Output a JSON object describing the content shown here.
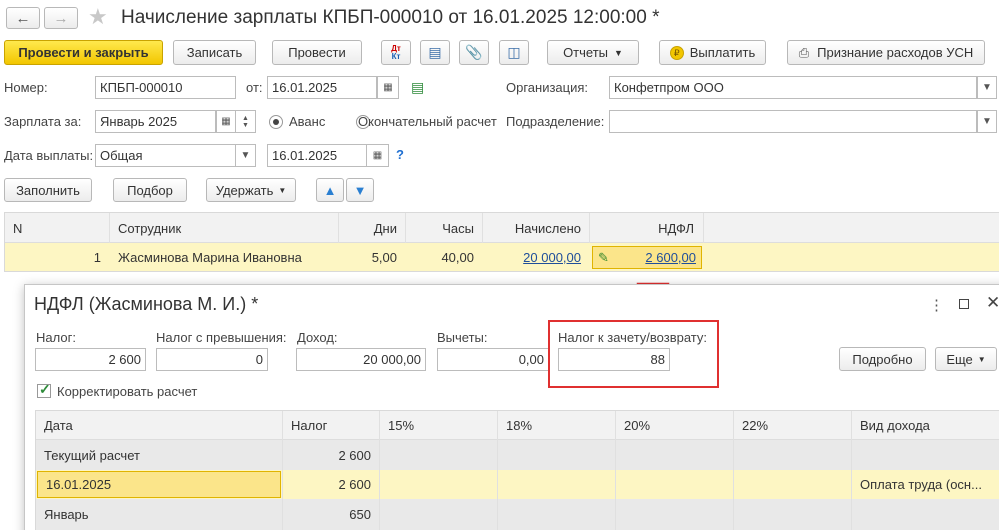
{
  "window": {
    "title": "Начисление зарплаты КПБП-000010 от 16.01.2025 12:00:00 *"
  },
  "toolbar": {
    "post_close": "Провести и закрыть",
    "save": "Записать",
    "post": "Провести",
    "reports": "Отчеты",
    "pay": "Выплатить",
    "usn": "Признание расходов УСН"
  },
  "form": {
    "number_label": "Номер:",
    "number_value": "КПБП-000010",
    "from_label": "от:",
    "date_value": "16.01.2025",
    "org_label": "Организация:",
    "org_value": "Конфетпром ООО",
    "salary_label": "Зарплата за:",
    "salary_value": "Январь 2025",
    "advance_label": "Аванс",
    "final_label": "Окончательный расчет",
    "dept_label": "Подразделение:",
    "dept_value": "",
    "pay_date_label": "Дата выплаты:",
    "pay_type_value": "Общая",
    "pay_date_value": "16.01.2025",
    "help": "?"
  },
  "actions": {
    "fill": "Заполнить",
    "select": "Подбор",
    "withhold": "Удержать"
  },
  "main_table": {
    "headers": [
      "N",
      "Сотрудник",
      "Дни",
      "Часы",
      "Начислено",
      "НДФЛ"
    ],
    "rows": [
      {
        "n": "1",
        "employee": "Жасминова Марина Ивановна",
        "days": "5,00",
        "hours": "40,00",
        "accrued": "20 000,00",
        "ndfl": "2 600,00"
      }
    ]
  },
  "dialog": {
    "title": "НДФЛ (Жасминова М. И.) *",
    "tax_label": "Налог:",
    "tax_value": "2 600",
    "excess_label": "Налог с превышения:",
    "excess_value": "0",
    "income_label": "Доход:",
    "income_value": "20 000,00",
    "deduct_label": "Вычеты:",
    "deduct_value": "0,00",
    "credit_label": "Налог к зачету/возврату:",
    "credit_value": "88",
    "details_button": "Подробно",
    "more_button": "Еще",
    "correct_label": "Корректировать расчет",
    "table_headers": [
      "Дата",
      "Налог",
      "15%",
      "18%",
      "20%",
      "22%",
      "Вид дохода"
    ],
    "rows": [
      {
        "date": "Текущий расчет",
        "tax": "2 600",
        "income_type": ""
      },
      {
        "date": "16.01.2025",
        "tax": "2 600",
        "income_type": "Оплата труда (осн..."
      },
      {
        "date": "Январь",
        "tax": "650",
        "income_type": ""
      }
    ]
  },
  "colors": {
    "accent_yellow": "#f2c600",
    "highlight_row": "#fdf6c3",
    "annotation_red": "#e03030"
  }
}
